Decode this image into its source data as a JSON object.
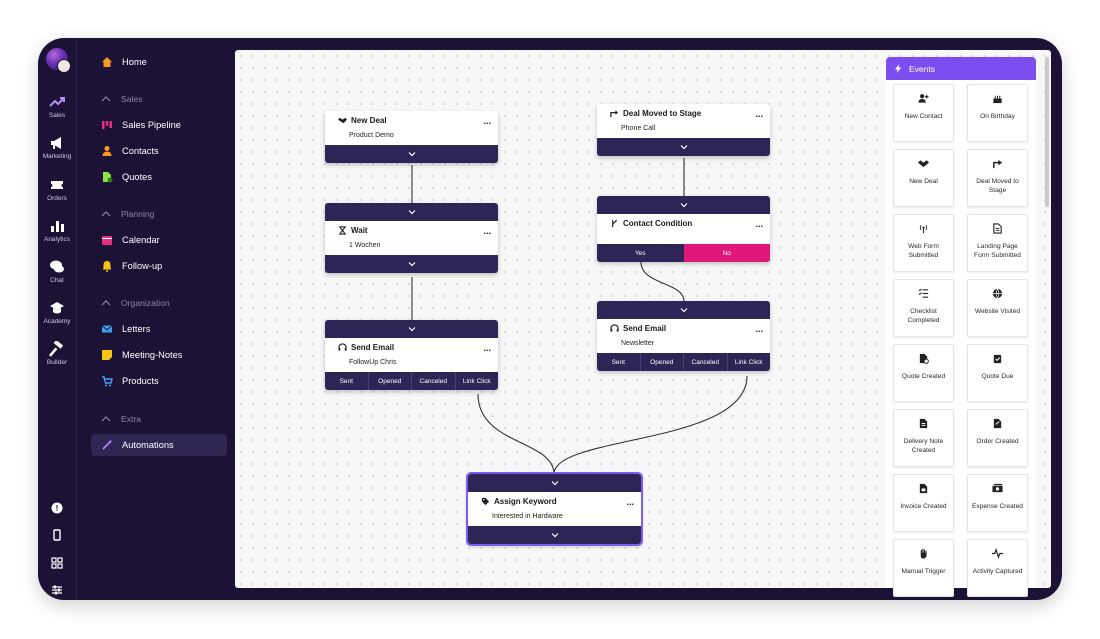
{
  "rail": {
    "items": [
      {
        "label": "Sales",
        "icon": "trending-up-icon"
      },
      {
        "label": "Marketing",
        "icon": "megaphone-icon"
      },
      {
        "label": "Orders",
        "icon": "ticket-icon"
      },
      {
        "label": "Analytics",
        "icon": "bar-chart-icon"
      },
      {
        "label": "Chat",
        "icon": "chat-icon"
      },
      {
        "label": "Academy",
        "icon": "graduation-cap-icon"
      },
      {
        "label": "Builder",
        "icon": "hammer-icon"
      }
    ],
    "bottom_icons": [
      "help-icon",
      "mobile-icon",
      "grid-icon",
      "sliders-icon"
    ]
  },
  "nav": {
    "home": "Home",
    "sections": [
      {
        "title": "Sales",
        "items": [
          "Sales Pipeline",
          "Contacts",
          "Quotes"
        ]
      },
      {
        "title": "Planning",
        "items": [
          "Calendar",
          "Follow-up"
        ]
      },
      {
        "title": "Organization",
        "items": [
          "Letters",
          "Meeting-Notes",
          "Products"
        ]
      },
      {
        "title": "Extra",
        "items": [
          "Automations"
        ]
      }
    ],
    "active": "Automations"
  },
  "nodes": {
    "new_deal": {
      "title": "New Deal",
      "sub": "Product Demo"
    },
    "wait": {
      "title": "Wait",
      "sub": "1 Wochen"
    },
    "send_email_1": {
      "title": "Send Email",
      "sub": "FollowUp Chris",
      "outs": [
        "Sent",
        "Opened",
        "Canceled",
        "Link Click"
      ]
    },
    "deal_moved": {
      "title": "Deal Moved to Stage",
      "sub": "Phone Call"
    },
    "condition": {
      "title": "Contact Condition",
      "yes": "Yes",
      "no": "No"
    },
    "send_email_2": {
      "title": "Send Email",
      "sub": "Newsletter",
      "outs": [
        "Sent",
        "Opened",
        "Canceled",
        "Link Click"
      ]
    },
    "assign_keyword": {
      "title": "Assign Keyword",
      "sub": "Interested in Hardware"
    },
    "menu": "..."
  },
  "events": {
    "title": "Events",
    "items": [
      {
        "label": "New Contact",
        "icon": "user-plus-icon"
      },
      {
        "label": "On Birthday",
        "icon": "cake-icon"
      },
      {
        "label": "New Deal",
        "icon": "handshake-icon"
      },
      {
        "label": "Deal Moved to Stage",
        "icon": "arrow-turn-icon"
      },
      {
        "label": "Web Form Submitted",
        "icon": "broadcast-icon"
      },
      {
        "label": "Landing Page Form Submitted",
        "icon": "document-icon"
      },
      {
        "label": "Checklist Completed",
        "icon": "checklist-icon"
      },
      {
        "label": "Website Visited",
        "icon": "globe-icon"
      },
      {
        "label": "Quote Created",
        "icon": "quote-file-icon"
      },
      {
        "label": "Quote Due",
        "icon": "clipboard-check-icon"
      },
      {
        "label": "Delivery Note Created",
        "icon": "delivery-file-icon"
      },
      {
        "label": "Order Created",
        "icon": "order-file-icon"
      },
      {
        "label": "Invoice Created",
        "icon": "invoice-icon"
      },
      {
        "label": "Expense Created",
        "icon": "money-icon"
      },
      {
        "label": "Manual Trigger",
        "icon": "hand-icon"
      },
      {
        "label": "Activity Captured",
        "icon": "pulse-icon"
      }
    ]
  },
  "colors": {
    "accent": "#7c4ef0",
    "node_bar": "#2e2456",
    "no_button": "#e0187a",
    "sidebar_bg": "#1c1236"
  }
}
